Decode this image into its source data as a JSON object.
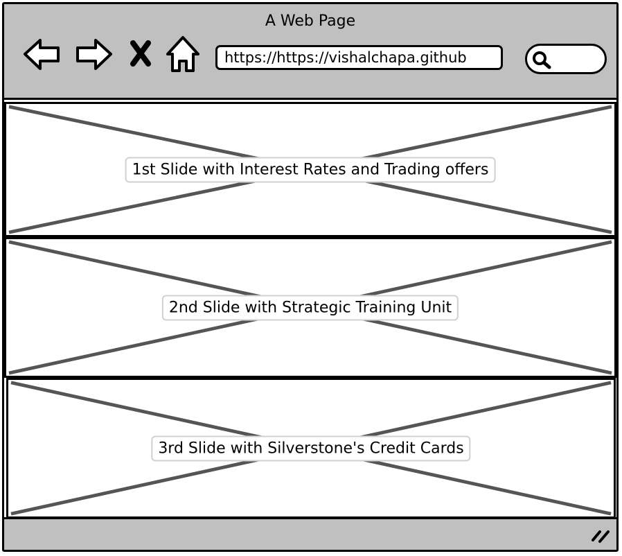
{
  "browser": {
    "title": "A Web Page",
    "url": "https://https://vishalchapa.github",
    "icons": {
      "back": "back-arrow-icon",
      "forward": "forward-arrow-icon",
      "close": "close-icon",
      "home": "home-icon",
      "search": "search-icon",
      "resize": "resize-grip-icon"
    }
  },
  "slides": [
    {
      "label": "1st Slide with Interest Rates and Trading offers"
    },
    {
      "label": "2nd Slide with Strategic Training Unit"
    },
    {
      "label": "3rd Slide with Silverstone's Credit Cards"
    }
  ],
  "colors": {
    "chrome": "#c0c0c0",
    "placeholder_cross": "#555555",
    "label_border": "#d0d0d0"
  }
}
